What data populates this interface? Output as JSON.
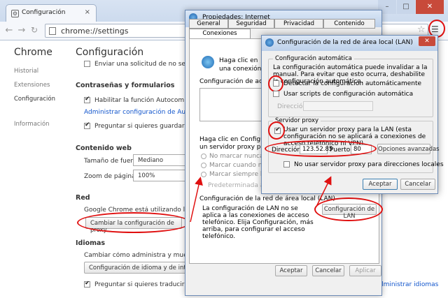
{
  "browser": {
    "tab_title": "Configuración",
    "url": "chrome://settings"
  },
  "sidebar": {
    "title": "Chrome",
    "items": [
      "Historial",
      "Extensiones",
      "Configuración",
      "Información"
    ]
  },
  "settings": {
    "title": "Configuración",
    "top_row": "Enviar una solicitud de no seguimien",
    "passwords": {
      "heading": "Contraseñas y formularios",
      "autofill": "Habilitar la función Autocompletar pa",
      "autofill_link": "Administrar configuración de Autocomplet",
      "save_passwords": "Preguntar si quieres guardar tus cont"
    },
    "web_content": {
      "heading": "Contenido web",
      "font_size_label": "Tamaño de fuente:",
      "font_size_value": "Mediano",
      "zoom_label": "Zoom de página:",
      "zoom_value": "100%"
    },
    "network": {
      "heading": "Red",
      "desc": "Google Chrome está utilizando la configur",
      "proxy_button": "Cambiar la configuración de proxy..."
    },
    "languages": {
      "heading": "Idiomas",
      "desc": "Cambiar cómo administra y muestra Chro",
      "button": "Configuración de idioma y de introduc",
      "translate": "Preguntar si quieres traducir páginas que no estén escritas en un idioma que entiendas.",
      "translate_link": "Administrar idiomas"
    }
  },
  "ie_dialog": {
    "title": "Propiedades: Internet",
    "tabs_row1": [
      "General",
      "Seguridad",
      "Privacidad",
      "Contenido"
    ],
    "tabs_row2": [
      "Conexiones"
    ],
    "intro_line1": "Haga clic en",
    "intro_line2": "una conexión a Inte",
    "vpn_label": "Configuración de acceso tel",
    "proxy_text_1": "Haga clic en Configuración",
    "proxy_text_2": "un servidor proxy para una",
    "radio1": "No marcar nunca una c",
    "radio2": "Marcar cuando no hay",
    "radio3": "Marcar siempre la conex",
    "predeterminada": "Predeterminada actualN",
    "lan_group": "Configuración de la red de área local (LAN)",
    "lan_text": "La configuración de LAN no se aplica a las conexiones de acceso telefónico. Elija Configuración, más arriba, para configurar el acceso telefónico.",
    "lan_button": "Configuración de LAN",
    "ok": "Aceptar",
    "cancel": "Cancelar",
    "apply": "Aplicar"
  },
  "lan_dialog": {
    "title": "Configuración de la red de área local (LAN)",
    "auto_group": "Configuración automática",
    "auto_text": "La configuración automática puede invalidar a la manual. Para evitar que esto ocurra, deshabilite la configuración automática.",
    "auto_detect": "Detectar la configuración automáticamente",
    "auto_script": "Usar scripts de configuración automática",
    "direccion_label": "Dirección",
    "proxy_group": "Servidor proxy",
    "use_proxy": "Usar un servidor proxy para la LAN (esta configuración no se aplicará a conexiones de acceso telefónico ni VPN).",
    "address_label": "Dirección:",
    "address_value": "123.52.85",
    "port_label": "Puerto:",
    "port_value": "80",
    "advanced": "Opciones avanzadas",
    "bypass": "No usar servidor proxy para direcciones locales",
    "ok": "Aceptar",
    "cancel": "Cancelar"
  }
}
